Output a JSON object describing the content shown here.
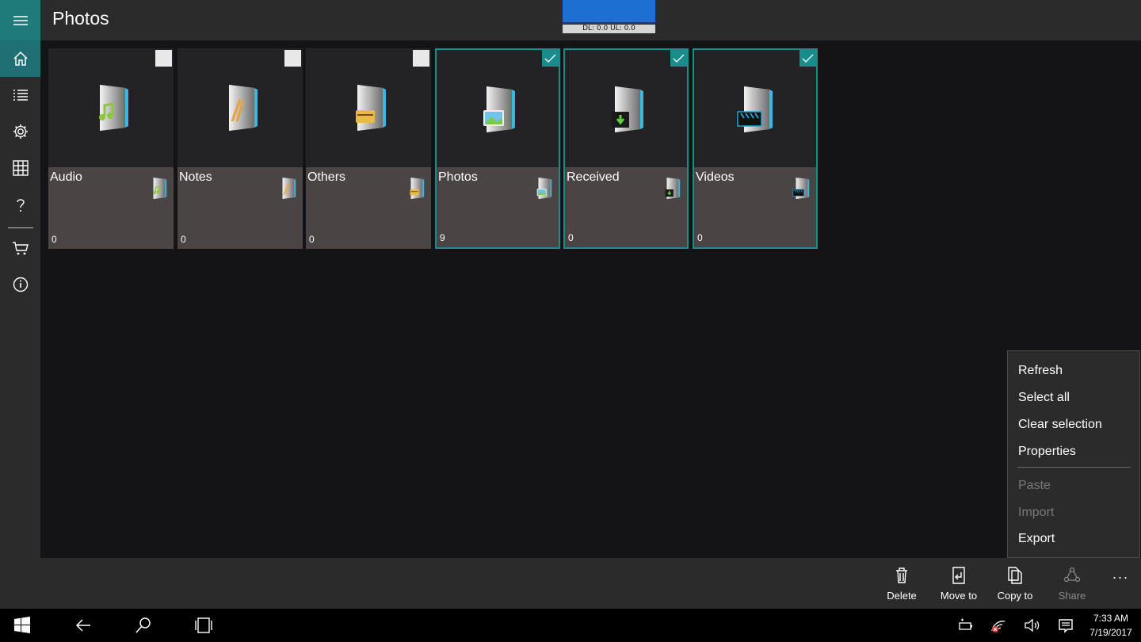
{
  "app": {
    "title": "Photos"
  },
  "network": {
    "label": "DL: 0.0 UL: 0.0"
  },
  "rail": {
    "items": [
      {
        "name": "hamburger",
        "icon": "hamburger-icon"
      },
      {
        "name": "home",
        "icon": "home-icon"
      },
      {
        "name": "list",
        "icon": "list-icon"
      },
      {
        "name": "settings",
        "icon": "gear-icon"
      },
      {
        "name": "grid",
        "icon": "grid-icon"
      },
      {
        "name": "help",
        "icon": "question-icon"
      },
      {
        "name": "store",
        "icon": "cart-icon"
      },
      {
        "name": "info",
        "icon": "info-icon"
      }
    ]
  },
  "folders": [
    {
      "name": "Audio",
      "count": "0",
      "selected": false,
      "badge_color": "#8dc63f"
    },
    {
      "name": "Notes",
      "count": "0",
      "selected": false,
      "badge_color": "#e8a33d"
    },
    {
      "name": "Others",
      "count": "0",
      "selected": false,
      "badge_color": "#e9b949"
    },
    {
      "name": "Photos",
      "count": "9",
      "selected": true,
      "badge_color": "#6fc3e8"
    },
    {
      "name": "Received",
      "count": "0",
      "selected": true,
      "badge_color": "#5bd33b"
    },
    {
      "name": "Videos",
      "count": "0",
      "selected": true,
      "badge_color": "#1fa3d6"
    }
  ],
  "context_menu": {
    "items": [
      {
        "label": "Refresh",
        "enabled": true
      },
      {
        "label": "Select all",
        "enabled": true
      },
      {
        "label": "Clear selection",
        "enabled": true
      },
      {
        "label": "Properties",
        "enabled": true
      },
      {
        "label": "Paste",
        "enabled": false
      },
      {
        "label": "Import",
        "enabled": false
      },
      {
        "label": "Export",
        "enabled": true
      }
    ]
  },
  "commands": [
    {
      "label": "Delete",
      "icon": "trash-icon",
      "enabled": true
    },
    {
      "label": "Move to",
      "icon": "move-icon",
      "enabled": true
    },
    {
      "label": "Copy to",
      "icon": "copy-icon",
      "enabled": true
    },
    {
      "label": "Share",
      "icon": "share-icon",
      "enabled": false
    }
  ],
  "more_label": "···",
  "taskbar": {
    "time": "7:33 AM",
    "date": "7/19/2017"
  },
  "colors": {
    "accent": "#1b8c8c",
    "chrome": "#2b2b2b",
    "background": "#141417",
    "tile_lower": "#4a4444"
  }
}
